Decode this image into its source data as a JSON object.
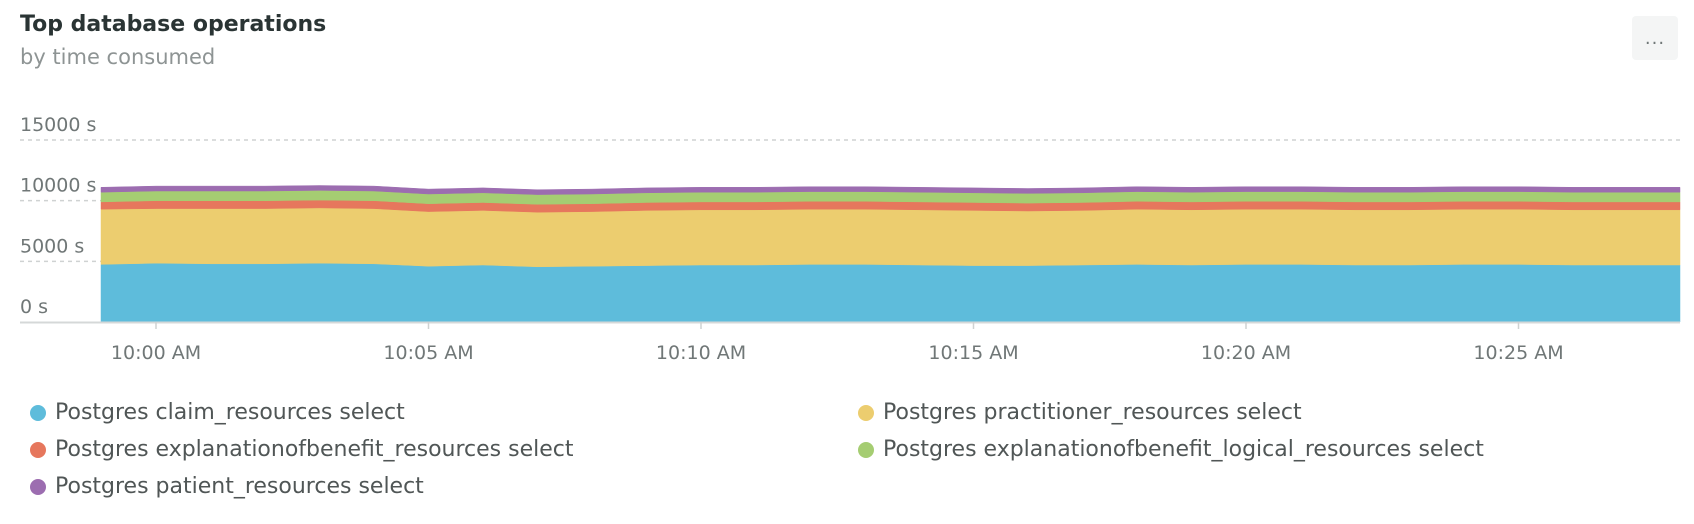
{
  "header": {
    "title": "Top database operations",
    "subtitle": "by time consumed",
    "menu_label": "..."
  },
  "chart_data": {
    "type": "area",
    "stacked": true,
    "grid": true,
    "legend_position": "bottom",
    "ylim": [
      0,
      15000
    ],
    "yticks": [
      {
        "value": 0,
        "label": "0 s"
      },
      {
        "value": 5000,
        "label": "5000 s"
      },
      {
        "value": 10000,
        "label": "10000 s"
      },
      {
        "value": 15000,
        "label": "15000 s"
      }
    ],
    "xticks": [
      "10:00 AM",
      "10:05 AM",
      "10:10 AM",
      "10:15 AM",
      "10:20 AM",
      "10:25 AM"
    ],
    "x": [
      "9:59 AM",
      "10:00 AM",
      "10:01 AM",
      "10:02 AM",
      "10:03 AM",
      "10:04 AM",
      "10:05 AM",
      "10:06 AM",
      "10:07 AM",
      "10:08 AM",
      "10:09 AM",
      "10:10 AM",
      "10:11 AM",
      "10:12 AM",
      "10:13 AM",
      "10:14 AM",
      "10:15 AM",
      "10:16 AM",
      "10:17 AM",
      "10:18 AM",
      "10:19 AM",
      "10:20 AM",
      "10:21 AM",
      "10:22 AM",
      "10:23 AM",
      "10:24 AM",
      "10:25 AM",
      "10:26 AM",
      "10:27 AM",
      "10:28 AM"
    ],
    "series": [
      {
        "name": "Postgres claim_resources select",
        "color": "#5ebcdb",
        "values": [
          4750,
          4850,
          4800,
          4800,
          4850,
          4800,
          4600,
          4700,
          4550,
          4600,
          4650,
          4700,
          4700,
          4750,
          4750,
          4700,
          4650,
          4650,
          4700,
          4750,
          4700,
          4750,
          4750,
          4700,
          4700,
          4750,
          4750,
          4700,
          4700,
          4700
        ]
      },
      {
        "name": "Postgres practitioner_resources select",
        "color": "#eccd6f",
        "values": [
          4550,
          4500,
          4550,
          4550,
          4550,
          4550,
          4500,
          4500,
          4500,
          4500,
          4550,
          4550,
          4550,
          4550,
          4550,
          4550,
          4550,
          4500,
          4500,
          4550,
          4550,
          4550,
          4550,
          4550,
          4550,
          4550,
          4550,
          4550,
          4550,
          4550
        ]
      },
      {
        "name": "Postgres explanationofbenefit_resources select",
        "color": "#e6775d",
        "values": [
          600,
          650,
          650,
          650,
          650,
          650,
          650,
          650,
          650,
          650,
          650,
          650,
          650,
          650,
          650,
          650,
          650,
          650,
          650,
          650,
          650,
          650,
          650,
          650,
          650,
          650,
          650,
          650,
          650,
          650
        ]
      },
      {
        "name": "Postgres explanationofbenefit_logical_resources select",
        "color": "#a5cd72",
        "values": [
          800,
          800,
          800,
          800,
          800,
          800,
          800,
          800,
          800,
          800,
          800,
          800,
          800,
          800,
          800,
          800,
          800,
          800,
          800,
          800,
          800,
          800,
          800,
          800,
          800,
          800,
          800,
          800,
          800,
          800
        ]
      },
      {
        "name": "Postgres patient_resources select",
        "color": "#9c6db0",
        "values": [
          400,
          400,
          400,
          400,
          400,
          400,
          400,
          400,
          400,
          400,
          400,
          400,
          400,
          400,
          400,
          400,
          400,
          400,
          400,
          400,
          400,
          400,
          400,
          400,
          400,
          400,
          400,
          400,
          400,
          400
        ]
      }
    ]
  }
}
